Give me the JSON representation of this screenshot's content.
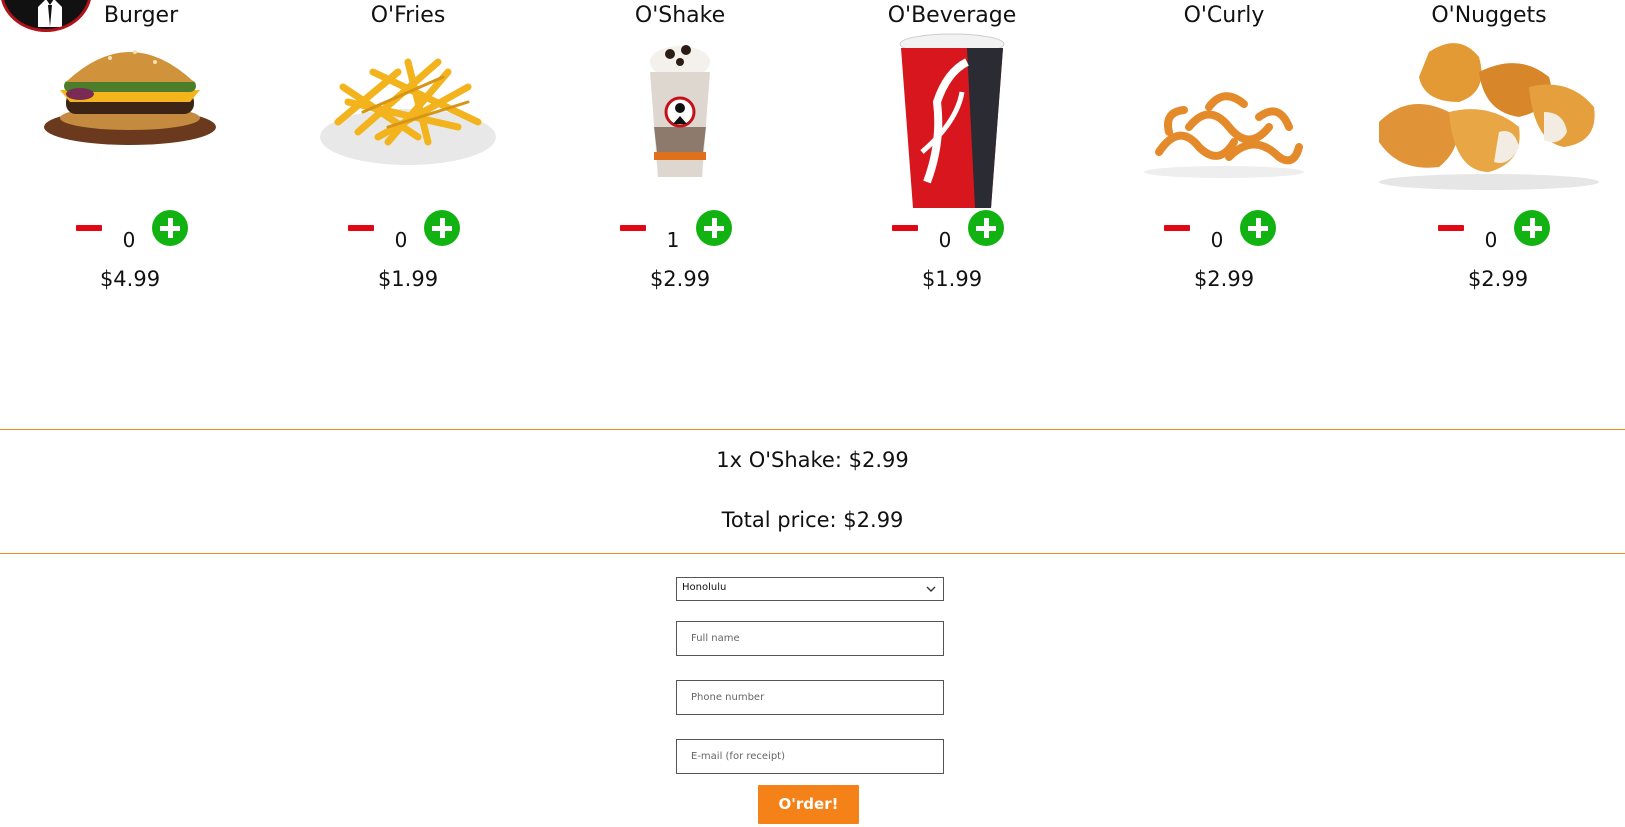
{
  "menu": {
    "items": [
      {
        "name": "Burger",
        "quantity": "0",
        "price": "$4.99",
        "image": "burger-image"
      },
      {
        "name": "O'Fries",
        "quantity": "0",
        "price": "$1.99",
        "image": "fries-image"
      },
      {
        "name": "O'Shake",
        "quantity": "1",
        "price": "$2.99",
        "image": "shake-image"
      },
      {
        "name": "O'Beverage",
        "quantity": "0",
        "price": "$1.99",
        "image": "soda-cup-image"
      },
      {
        "name": "O'Curly",
        "quantity": "0",
        "price": "$2.99",
        "image": "curly-fries-image"
      },
      {
        "name": "O'Nuggets",
        "quantity": "0",
        "price": "$2.99",
        "image": "nuggets-image"
      }
    ]
  },
  "summary": {
    "order_line": "1x O'Shake: $2.99",
    "total": "Total price: $2.99"
  },
  "form": {
    "location_selected": "Honolulu",
    "full_name_placeholder": "Full name",
    "phone_placeholder": "Phone number",
    "email_placeholder": "E-mail (for receipt)",
    "order_button": "O'rder!"
  },
  "colors": {
    "accent": "#f58219",
    "minus": "#e30613",
    "plus": "#12b212",
    "divider": "#f08a1a"
  }
}
